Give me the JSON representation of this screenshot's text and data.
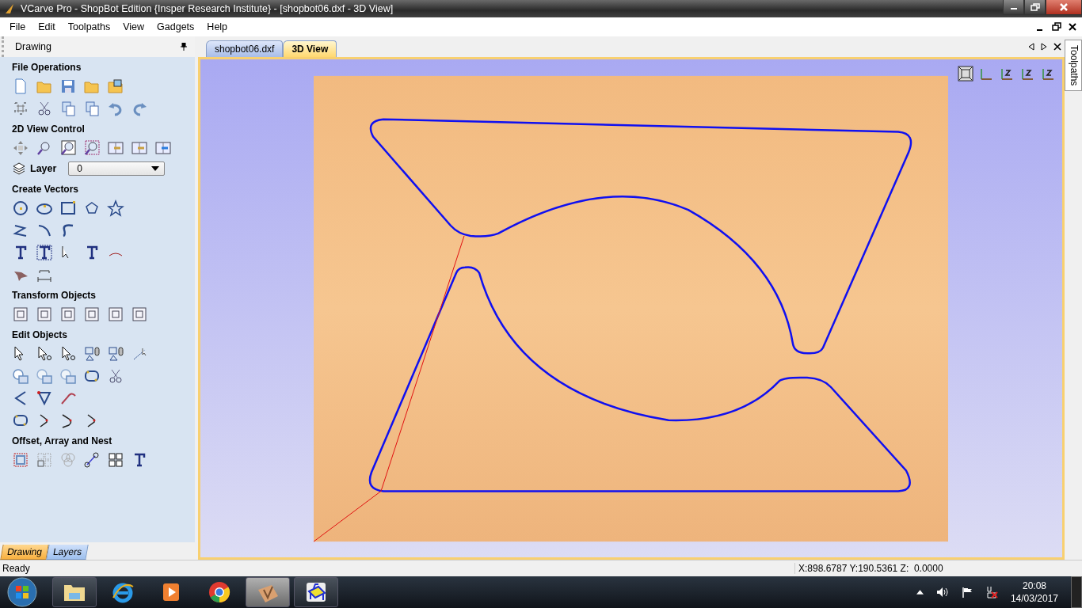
{
  "window": {
    "title": "VCarve Pro - ShopBot Edition {Insper Research Institute} - [shopbot06.dxf - 3D View]"
  },
  "menu": [
    "File",
    "Edit",
    "Toolpaths",
    "View",
    "Gadgets",
    "Help"
  ],
  "panel": {
    "title": "Drawing",
    "sections": [
      {
        "kind": "tools",
        "title": "File Operations"
      },
      {
        "kind": "tools",
        "title": "2D View Control"
      },
      {
        "kind": "layer",
        "title": "Layer",
        "value": "0"
      },
      {
        "kind": "tools",
        "title": "Create Vectors"
      },
      {
        "kind": "tools",
        "title": "Transform Objects"
      },
      {
        "kind": "tools",
        "title": "Edit Objects"
      },
      {
        "kind": "tools",
        "title": "Offset, Array and Nest"
      }
    ]
  },
  "panel_tabs": [
    {
      "label": "Drawing",
      "selected": true
    },
    {
      "label": "Layers",
      "selected": false
    }
  ],
  "doc_tabs": [
    {
      "label": "shopbot06.dxf",
      "selected": false
    },
    {
      "label": "3D View",
      "selected": true
    }
  ],
  "side_tab": {
    "label": "Toolpaths"
  },
  "status_bar": {
    "message": "Ready",
    "coordinates": "X:898.6787 Y:190.5361 Z:  0.0000"
  },
  "taskbar": {
    "time": "20:08",
    "date": "14/03/2017"
  }
}
